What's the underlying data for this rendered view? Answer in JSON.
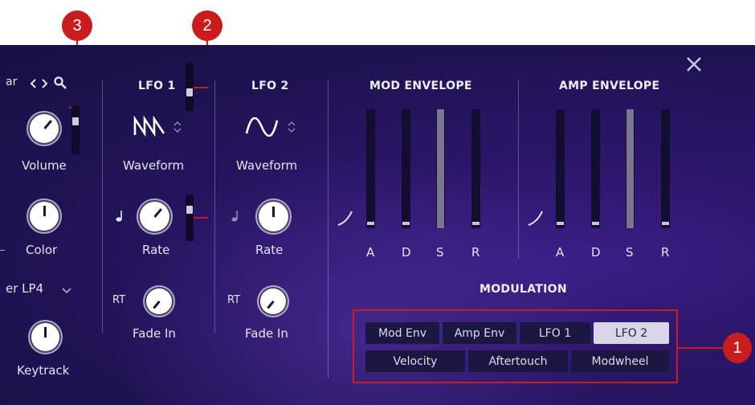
{
  "callouts": {
    "one": "1",
    "two": "2",
    "three": "3"
  },
  "left_column": {
    "preset_partial": "ar",
    "volume_label": "Volume",
    "color_label": "Color",
    "filter_partial": "er LP4",
    "keytrack_label": "Keytrack"
  },
  "lfo1": {
    "title": "LFO 1",
    "waveform_label": "Waveform",
    "rate_label": "Rate",
    "rt_label": "RT",
    "fadein_label": "Fade In"
  },
  "lfo2": {
    "title": "LFO 2",
    "waveform_label": "Waveform",
    "rate_label": "Rate",
    "rt_label": "RT",
    "fadein_label": "Fade In"
  },
  "mod_envelope": {
    "title": "MOD ENVELOPE",
    "labels": [
      "A",
      "D",
      "S",
      "R"
    ]
  },
  "amp_envelope": {
    "title": "AMP ENVELOPE",
    "labels": [
      "A",
      "D",
      "S",
      "R"
    ]
  },
  "modulation": {
    "title": "MODULATION",
    "row1": [
      "Mod Env",
      "Amp Env",
      "LFO 1",
      "LFO 2"
    ],
    "row2": [
      "Velocity",
      "Aftertouch",
      "Modwheel"
    ],
    "selected": "LFO 2"
  },
  "icons": {
    "close": "close-icon",
    "search": "search-icon",
    "lfo1_wave": "sawtooth-wave-icon",
    "lfo2_wave": "sine-wave-icon",
    "note": "note-icon",
    "env_curve": "curve-icon"
  },
  "colors": {
    "callout": "#c91d1d",
    "panel": "#231660",
    "active_button": "#d8d6e8"
  }
}
